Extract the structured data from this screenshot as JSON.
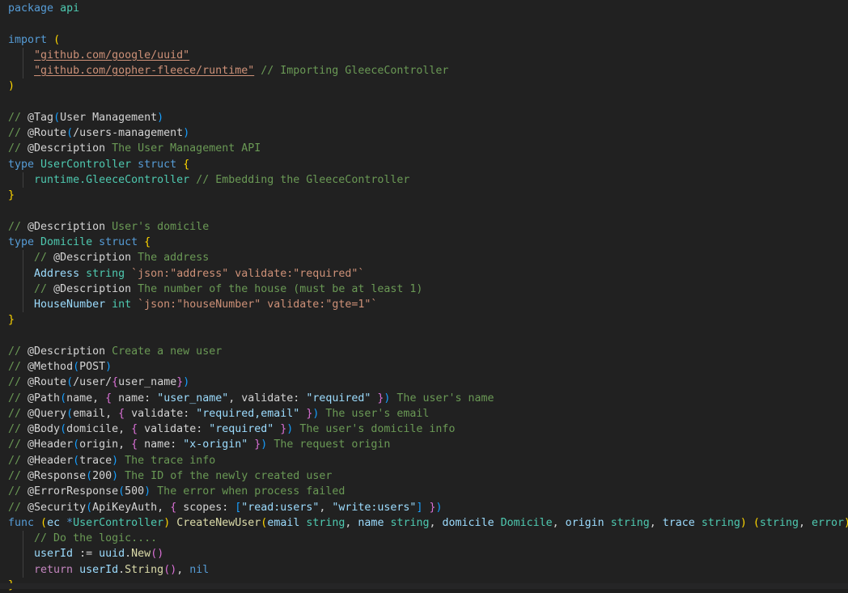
{
  "editor": {
    "language": "go",
    "package_name": "api",
    "background_color": "#212121",
    "foreground_color": "#d4d4d4",
    "font_size_px": 13.3,
    "line_height_px": 19.28
  },
  "theme_colors": {
    "keyword": "#569cd6",
    "control": "#c586c0",
    "type": "#4ec9b0",
    "variable": "#9cdcfe",
    "function": "#dcdcaa",
    "string": "#ce9178",
    "number": "#b5cea8",
    "comment": "#6a9955",
    "annotation": "#d4d4d4",
    "bracket_level_1": "#ffd700",
    "bracket_level_2": "#da70d6",
    "bracket_level_3": "#179fff",
    "indent_guide": "#404040"
  },
  "lines": [
    {
      "n": 1,
      "text": "package api"
    },
    {
      "n": 2,
      "text": ""
    },
    {
      "n": 3,
      "text": "import ("
    },
    {
      "n": 4,
      "text": "    \"github.com/google/uuid\""
    },
    {
      "n": 5,
      "text": "    \"github.com/gopher-fleece/runtime\" // Importing GleeceController"
    },
    {
      "n": 6,
      "text": ")"
    },
    {
      "n": 7,
      "text": ""
    },
    {
      "n": 8,
      "text": "// @Tag(User Management)"
    },
    {
      "n": 9,
      "text": "// @Route(/users-management)"
    },
    {
      "n": 10,
      "text": "// @Description The User Management API"
    },
    {
      "n": 11,
      "text": "type UserController struct {"
    },
    {
      "n": 12,
      "text": "    runtime.GleeceController // Embedding the GleeceController"
    },
    {
      "n": 13,
      "text": "}"
    },
    {
      "n": 14,
      "text": ""
    },
    {
      "n": 15,
      "text": "// @Description User's domicile"
    },
    {
      "n": 16,
      "text": "type Domicile struct {"
    },
    {
      "n": 17,
      "text": "    // @Description The address"
    },
    {
      "n": 18,
      "text": "    Address string `json:\"address\" validate:\"required\"`"
    },
    {
      "n": 19,
      "text": "    // @Description The number of the house (must be at least 1)"
    },
    {
      "n": 20,
      "text": "    HouseNumber int `json:\"houseNumber\" validate:\"gte=1\"`"
    },
    {
      "n": 21,
      "text": "}"
    },
    {
      "n": 22,
      "text": ""
    },
    {
      "n": 23,
      "text": "// @Description Create a new user"
    },
    {
      "n": 24,
      "text": "// @Method(POST)"
    },
    {
      "n": 25,
      "text": "// @Route(/user/{user_name})"
    },
    {
      "n": 26,
      "text": "// @Path(name, { name: \"user_name\", validate: \"required\" }) The user's name"
    },
    {
      "n": 27,
      "text": "// @Query(email, { validate: \"required,email\" }) The user's email"
    },
    {
      "n": 28,
      "text": "// @Body(domicile, { validate: \"required\" }) The user's domicile info"
    },
    {
      "n": 29,
      "text": "// @Header(origin, { name: \"x-origin\" }) The request origin"
    },
    {
      "n": 30,
      "text": "// @Header(trace) The trace info"
    },
    {
      "n": 31,
      "text": "// @Response(200) The ID of the newly created user"
    },
    {
      "n": 32,
      "text": "// @ErrorResponse(500) The error when process failed"
    },
    {
      "n": 33,
      "text": "// @Security(ApiKeyAuth, { scopes: [\"read:users\", \"write:users\"] })"
    },
    {
      "n": 34,
      "text": "func (ec *UserController) CreateNewUser(email string, name string, domicile Domicile, origin string, trace string) (string, error) {"
    },
    {
      "n": 35,
      "text": "    // Do the logic...."
    },
    {
      "n": 36,
      "text": "    userId := uuid.New()"
    },
    {
      "n": 37,
      "text": "    return userId.String(), nil"
    },
    {
      "n": 38,
      "text": "}"
    }
  ],
  "tokens": {
    "l1": {
      "kw_package": "package",
      "pkg_name": "api"
    },
    "l3": {
      "kw_import": "import",
      "paren": "("
    },
    "l4": {
      "import_path": "\"github.com/google/uuid\""
    },
    "l5": {
      "import_path": "\"github.com/gopher-fleece/runtime\"",
      "comment": "// Importing GleeceController"
    },
    "l6": {
      "paren": ")"
    },
    "l8": {
      "slashes": "// ",
      "anno": "@Tag",
      "open": "(",
      "arg": "User Management",
      "close": ")"
    },
    "l9": {
      "slashes": "// ",
      "anno": "@Route",
      "open": "(",
      "arg": "/users-management",
      "close": ")"
    },
    "l10": {
      "slashes": "// ",
      "anno": "@Description",
      "desc": " The User Management API"
    },
    "l11": {
      "kw_type": "type",
      "name": "UserController",
      "kw_struct": "struct",
      "brace": "{"
    },
    "l12": {
      "recv": "runtime.GleeceController",
      "comment": "// Embedding the GleeceController"
    },
    "l13": {
      "brace": "}"
    },
    "l15": {
      "slashes": "// ",
      "anno": "@Description",
      "desc": " User's domicile"
    },
    "l16": {
      "kw_type": "type",
      "name": "Domicile",
      "kw_struct": "struct",
      "brace": "{"
    },
    "l17": {
      "slashes": "// ",
      "anno": "@Description",
      "desc": " The address"
    },
    "l18": {
      "field": "Address",
      "ftype": "string",
      "tag": "`json:\"address\" validate:\"required\"`"
    },
    "l19": {
      "slashes": "// ",
      "anno": "@Description",
      "desc": " The number of the house (must be at least 1)"
    },
    "l20": {
      "field": "HouseNumber",
      "ftype": "int",
      "tag": "`json:\"houseNumber\" validate:\"gte=1\"`"
    },
    "l21": {
      "brace": "}"
    },
    "l23": {
      "slashes": "// ",
      "anno": "@Description",
      "desc": " Create a new user"
    },
    "l24": {
      "slashes": "// ",
      "anno": "@Method",
      "open": "(",
      "arg": "POST",
      "close": ")"
    },
    "l25_a": {
      "slashes": "// ",
      "anno": "@Route",
      "open": "(",
      "arg1": "/user/",
      "brace_o": "{",
      "arg2": "user_name",
      "brace_c": "}",
      "close": ")"
    },
    "l26": {
      "slashes": "// ",
      "anno": "@Path",
      "open": "(",
      "id": "name",
      "comma": ", ",
      "brace_o": "{ ",
      "key": "name: ",
      "val": "\"user_name\"",
      "comma2": ", ",
      "key2": "validate: ",
      "val2": "\"required\"",
      "brace_c": " }",
      "close": ")",
      "desc": " The user's name"
    },
    "l27": {
      "slashes": "// ",
      "anno": "@Query",
      "open": "(",
      "id": "email",
      "comma": ", ",
      "brace_o": "{ ",
      "key": "validate: ",
      "val": "\"required,email\"",
      "brace_c": " }",
      "close": ")",
      "desc": " The user's email"
    },
    "l28": {
      "slashes": "// ",
      "anno": "@Body",
      "open": "(",
      "id": "domicile",
      "comma": ", ",
      "brace_o": "{ ",
      "key": "validate: ",
      "val": "\"required\"",
      "brace_c": " }",
      "close": ")",
      "desc": " The user's domicile info"
    },
    "l29": {
      "slashes": "// ",
      "anno": "@Header",
      "open": "(",
      "id": "origin",
      "comma": ", ",
      "brace_o": "{ ",
      "key": "name: ",
      "val": "\"x-origin\"",
      "brace_c": " }",
      "close": ")",
      "desc": " The request origin"
    },
    "l30": {
      "slashes": "// ",
      "anno": "@Header",
      "open": "(",
      "id": "trace",
      "close": ")",
      "desc": " The trace info"
    },
    "l31": {
      "slashes": "// ",
      "anno": "@Response",
      "open": "(",
      "num": "200",
      "close": ")",
      "desc": " The ID of the newly created user"
    },
    "l32": {
      "slashes": "// ",
      "anno": "@ErrorResponse",
      "open": "(",
      "num": "500",
      "close": ")",
      "desc": " The error when process failed"
    },
    "l33": {
      "slashes": "// ",
      "anno": "@Security",
      "open": "(",
      "id": "ApiKeyAuth",
      "comma": ", ",
      "brace_o": "{ ",
      "key": "scopes: ",
      "brk_o": "[",
      "val1": "\"read:users\"",
      "comma2": ", ",
      "val2": "\"write:users\"",
      "brk_c": "]",
      "brace_c": " }",
      "close": ")"
    },
    "l34": {
      "kw_func": "func",
      "recv_open": "(",
      "recv_name": "ec",
      "recv_star": "*",
      "recv_type": "UserController",
      "recv_close": ")",
      "fn_name": "CreateNewUser",
      "args_open": "(",
      "p1": "email",
      "t1": "string",
      "p2": "name",
      "t2": "string",
      "p3": "domicile",
      "t3": "Domicile",
      "p4": "origin",
      "t4": "string",
      "p5": "trace",
      "t5": "string",
      "args_close": ")",
      "ret_open": "(",
      "ret1": "string",
      "ret2": "error",
      "ret_close": ")",
      "body_brace": "{"
    },
    "l35": {
      "comment": "// Do the logic...."
    },
    "l36": {
      "var": "userId",
      "op": " := ",
      "pkg": "uuid",
      "dot": ".",
      "fn": "New",
      "open": "(",
      "close": ")"
    },
    "l37": {
      "kw_return": "return",
      "var": "userId",
      "dot": ".",
      "fn": "String",
      "open": "(",
      "close": ")",
      "comma": ",",
      "nil": "nil"
    },
    "l38": {
      "brace": "}"
    }
  }
}
